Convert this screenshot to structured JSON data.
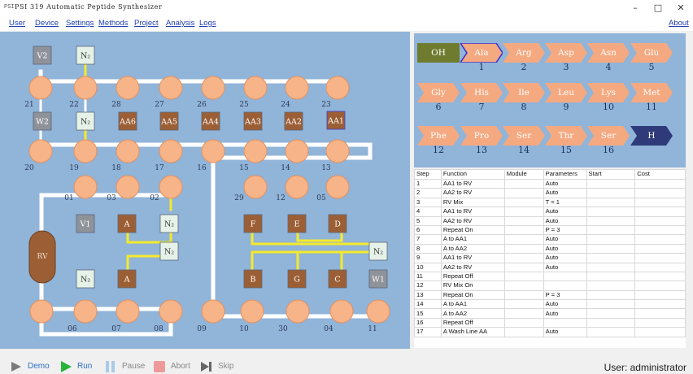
{
  "window": {
    "title": "PSI 319 Automatic Peptide Synthesizer",
    "app_icon": "PSI"
  },
  "menu": [
    "User",
    "Device",
    "Settings",
    "Methods",
    "Project",
    "Analysis",
    "Logs"
  ],
  "about": "About",
  "colors": {
    "panel": "#91b4d9",
    "valve": "#f7b488",
    "valve_border": "#e4915f",
    "line": "#ffffff",
    "reagent": "#9c5f35",
    "gray_box": "#8e9299",
    "n2_box": "#e6f2e8",
    "yellow": "#f5ea2a",
    "chip_orange": "#f4a980",
    "chip_green": "#6f7b2e",
    "chip_navy": "#2e3a7a"
  },
  "board": {
    "valves_row1": [
      "21",
      "22",
      "28",
      "27",
      "26",
      "25",
      "24",
      "23"
    ],
    "valves_row2": [
      "20",
      "19",
      "18",
      "17",
      "16",
      "15",
      "14",
      "13"
    ],
    "valves_row3": [
      "01",
      "03",
      "02",
      "29",
      "12",
      "05"
    ],
    "valves_row4": [
      "06",
      "07",
      "08",
      "09",
      "10",
      "30",
      "04",
      "11"
    ],
    "boxes": {
      "v2": "V2",
      "n2_top": "N₂",
      "w2": "W2",
      "n2_mid": "N₂",
      "aa": [
        "AA6",
        "AA5",
        "AA4",
        "AA3",
        "AA2",
        "AA1"
      ],
      "v1": "V1",
      "a_top": "A",
      "n2_a": "N₂",
      "n2_center": "N₂",
      "f": "F",
      "e": "E",
      "d": "D",
      "n2_right": "N₂",
      "n2_bottom": "N₂",
      "a_bottom": "A",
      "b": "B",
      "g": "G",
      "c": "C",
      "w1": "W1",
      "rv": "RV"
    }
  },
  "peptide": {
    "chips": [
      {
        "label": "OH",
        "num": "",
        "style": "green"
      },
      {
        "label": "Ala",
        "num": "1",
        "style": "active"
      },
      {
        "label": "Arg",
        "num": "2",
        "style": "normal"
      },
      {
        "label": "Asp",
        "num": "3",
        "style": "normal"
      },
      {
        "label": "Asn",
        "num": "4",
        "style": "normal"
      },
      {
        "label": "Glu",
        "num": "5",
        "style": "normal"
      },
      {
        "label": "Gly",
        "num": "6",
        "style": "normal"
      },
      {
        "label": "His",
        "num": "7",
        "style": "normal"
      },
      {
        "label": "Ile",
        "num": "8",
        "style": "normal"
      },
      {
        "label": "Leu",
        "num": "9",
        "style": "normal"
      },
      {
        "label": "Lys",
        "num": "10",
        "style": "normal"
      },
      {
        "label": "Met",
        "num": "11",
        "style": "normal"
      },
      {
        "label": "Phe",
        "num": "12",
        "style": "normal"
      },
      {
        "label": "Pro",
        "num": "13",
        "style": "normal"
      },
      {
        "label": "Ser",
        "num": "14",
        "style": "normal"
      },
      {
        "label": "Thr",
        "num": "15",
        "style": "normal"
      },
      {
        "label": "Ser",
        "num": "16",
        "style": "normal"
      },
      {
        "label": "H",
        "num": "",
        "style": "navy"
      }
    ]
  },
  "steps": {
    "headers": [
      "Step",
      "Function",
      "Module",
      "Parameters",
      "Start",
      "Cost"
    ],
    "rows": [
      [
        "1",
        "AA1 to RV",
        "",
        "Auto",
        "",
        ""
      ],
      [
        "2",
        "AA2 to RV",
        "",
        "Auto",
        "",
        ""
      ],
      [
        "3",
        "RV Mix",
        "",
        "T = 1",
        "",
        ""
      ],
      [
        "4",
        "AA1 to RV",
        "",
        "Auto",
        "",
        ""
      ],
      [
        "5",
        "AA2 to RV",
        "",
        "Auto",
        "",
        ""
      ],
      [
        "6",
        "Repeat On",
        "",
        "P = 3",
        "",
        ""
      ],
      [
        "7",
        "A to AA1",
        "",
        "Auto",
        "",
        ""
      ],
      [
        "8",
        "A to AA2",
        "",
        "Auto",
        "",
        ""
      ],
      [
        "9",
        "AA1 to RV",
        "",
        "Auto",
        "",
        ""
      ],
      [
        "10",
        "AA2 to RV",
        "",
        "Auto",
        "",
        ""
      ],
      [
        "11",
        "Repeat Off",
        "",
        "",
        "",
        ""
      ],
      [
        "12",
        "RV Mix On",
        "",
        "",
        "",
        ""
      ],
      [
        "13",
        "Repeat On",
        "",
        "P = 3",
        "",
        ""
      ],
      [
        "14",
        "A to AA1",
        "",
        "Auto",
        "",
        ""
      ],
      [
        "15",
        "A to AA2",
        "",
        "Auto",
        "",
        ""
      ],
      [
        "16",
        "Repeat Off",
        "",
        "",
        "",
        ""
      ],
      [
        "17",
        "A Wash Line AA",
        "",
        "Auto",
        "",
        ""
      ]
    ]
  },
  "controls": {
    "demo": "Demo",
    "run": "Run",
    "pause": "Pause",
    "abort": "Abort",
    "skip": "Skip"
  },
  "status": {
    "user": "User: administrator"
  }
}
